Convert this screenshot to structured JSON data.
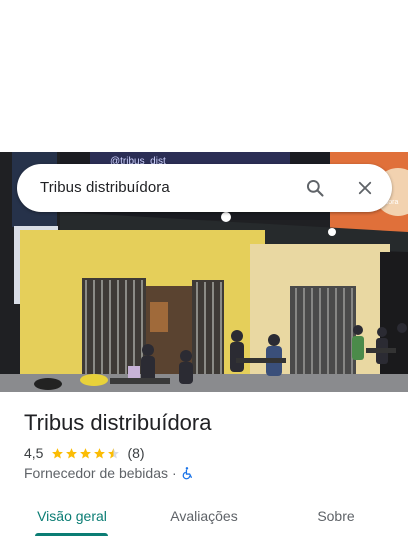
{
  "search": {
    "query": "Tribus distribuídora",
    "search_icon": "search-icon",
    "close_icon": "close-icon"
  },
  "photo": {
    "sign_left": "@tribus_dist",
    "sign_right": "@tribusdistribuidora"
  },
  "place": {
    "name": "Tribus distribuídora",
    "rating": "4,5",
    "stars": 4.5,
    "reviews": "(8)",
    "category": "Fornecedor de bebidas",
    "separator": "·",
    "accessibility_icon": "wheelchair-icon"
  },
  "tabs": [
    {
      "label": "Visão geral",
      "active": true
    },
    {
      "label": "Avaliações",
      "active": false
    },
    {
      "label": "Sobre",
      "active": false
    }
  ],
  "colors": {
    "accent": "#0b7d74",
    "star": "#fbbc04",
    "accessibility": "#1a73e8"
  }
}
